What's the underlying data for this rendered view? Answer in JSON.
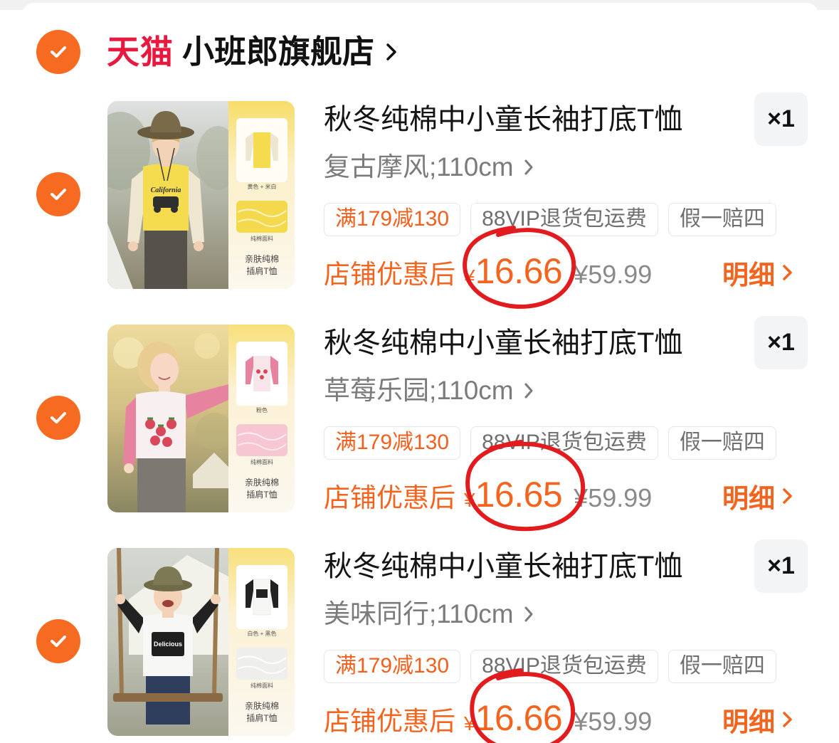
{
  "colors": {
    "accent": "#f76a22",
    "platform_red": "#e8183f",
    "price_orange": "#f3641f",
    "highlight_red": "#e11b1e"
  },
  "store": {
    "platform": "天猫",
    "name": "小班郎旗舰店",
    "selected": true
  },
  "items": [
    {
      "selected": true,
      "title": "秋冬纯棉中小童长袖打底T恤",
      "quantity": "×1",
      "variant": "复古摩风;110cm",
      "tags": [
        "满179减130",
        "88VIP退货包运费",
        "假一赔四"
      ],
      "price_label": "店铺优惠后",
      "currency": "¥",
      "price": "16.66",
      "original_price": "¥59.99",
      "detail_label": "明细",
      "price_highlighted": true,
      "image": {
        "print_text": "California",
        "swatch_label": "黄色 + 米白",
        "fabric_label": "纯棉面料",
        "feature_line1": "亲肤纯棉",
        "feature_line2": "插肩T恤"
      }
    },
    {
      "selected": true,
      "title": "秋冬纯棉中小童长袖打底T恤",
      "quantity": "×1",
      "variant": "草莓乐园;110cm",
      "tags": [
        "满179减130",
        "88VIP退货包运费",
        "假一赔四"
      ],
      "price_label": "店铺优惠后",
      "currency": "¥",
      "price": "16.65",
      "original_price": "¥59.99",
      "detail_label": "明细",
      "price_highlighted": true,
      "image": {
        "swatch_label": "粉色",
        "fabric_label": "纯棉面料",
        "feature_line1": "亲肤纯棉",
        "feature_line2": "插肩T恤"
      }
    },
    {
      "selected": true,
      "title": "秋冬纯棉中小童长袖打底T恤",
      "quantity": "×1",
      "variant": "美味同行;110cm",
      "tags": [
        "满179减130",
        "88VIP退货包运费",
        "假一赔四"
      ],
      "price_label": "店铺优惠后",
      "currency": "¥",
      "price": "16.66",
      "original_price": "¥59.99",
      "detail_label": "明细",
      "price_highlighted": true,
      "image": {
        "print_text": "Delicious",
        "swatch_label": "白色 + 黑色",
        "fabric_label": "纯棉面料",
        "feature_line1": "亲肤纯棉",
        "feature_line2": "插肩T恤"
      }
    }
  ]
}
